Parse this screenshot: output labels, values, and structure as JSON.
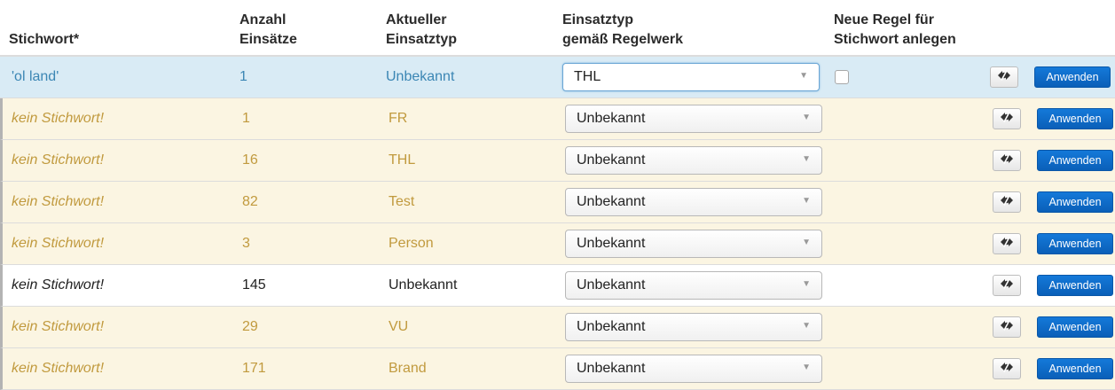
{
  "header": {
    "stichwort": "Stichwort*",
    "anzahl_1": "Anzahl",
    "anzahl_2": "Einsätze",
    "aktuell_1": "Aktueller",
    "aktuell_2": "Einsatztyp",
    "regel_1": "Einsatztyp",
    "regel_2": "gemäß Regelwerk",
    "neu_1": "Neue Regel für",
    "neu_2": "Stichwort anlegen"
  },
  "rows": [
    {
      "keyword": "'ol land'",
      "count": "1",
      "type": "Unbekannt",
      "select": "THL",
      "state": "active",
      "checkbox": true
    },
    {
      "keyword": "kein Stichwort!",
      "count": "1",
      "type": "FR",
      "select": "Unbekannt",
      "state": "warn"
    },
    {
      "keyword": "kein Stichwort!",
      "count": "16",
      "type": "THL",
      "select": "Unbekannt",
      "state": "warn"
    },
    {
      "keyword": "kein Stichwort!",
      "count": "82",
      "type": "Test",
      "select": "Unbekannt",
      "state": "warn"
    },
    {
      "keyword": "kein Stichwort!",
      "count": "3",
      "type": "Person",
      "select": "Unbekannt",
      "state": "warn"
    },
    {
      "keyword": "kein Stichwort!",
      "count": "145",
      "type": "Unbekannt",
      "select": "Unbekannt",
      "state": "plain"
    },
    {
      "keyword": "kein Stichwort!",
      "count": "29",
      "type": "VU",
      "select": "Unbekannt",
      "state": "warn"
    },
    {
      "keyword": "kein Stichwort!",
      "count": "171",
      "type": "Brand",
      "select": "Unbekannt",
      "state": "warn"
    }
  ],
  "apply_label": "Anwenden",
  "colors": {
    "accent": "#0d67c6",
    "active_row": "#d9ebf5",
    "warn_row": "#fbf5e2",
    "warn_text": "#c19a3e"
  }
}
